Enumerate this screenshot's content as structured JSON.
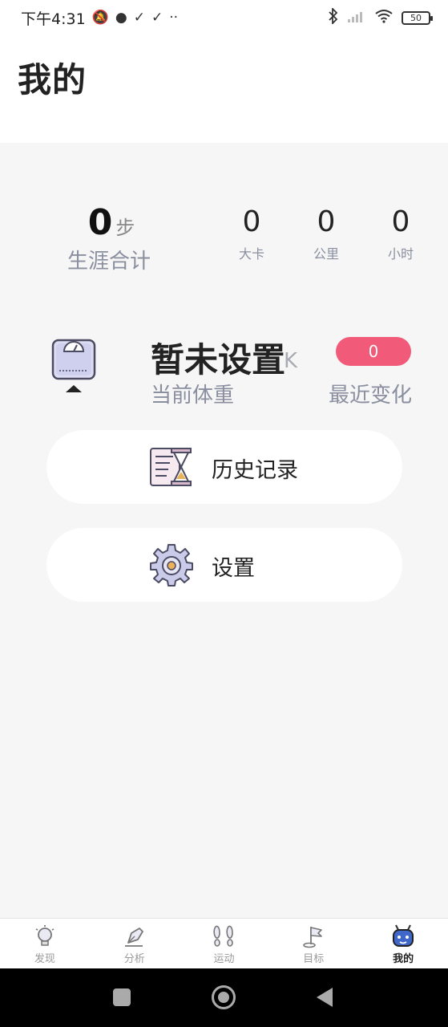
{
  "status_bar": {
    "time": "下午4:31",
    "battery": "50"
  },
  "header": {
    "title": "我的"
  },
  "stats": {
    "career_value": "0",
    "career_unit": "步",
    "career_label": "生涯合计",
    "items": [
      {
        "value": "0",
        "label": "大卡"
      },
      {
        "value": "0",
        "label": "公里"
      },
      {
        "value": "0",
        "label": "小时"
      }
    ]
  },
  "weight": {
    "current_value": "暂未设置",
    "unit": "K",
    "current_label": "当前体重",
    "change_value": "0",
    "change_label": "最近变化"
  },
  "menu": {
    "history_label": "历史记录",
    "settings_label": "设置"
  },
  "tabbar": {
    "tabs": [
      {
        "label": "发现",
        "icon": "lightbulb-icon"
      },
      {
        "label": "分析",
        "icon": "pen-icon"
      },
      {
        "label": "运动",
        "icon": "footprints-icon"
      },
      {
        "label": "目标",
        "icon": "flag-icon"
      },
      {
        "label": "我的",
        "icon": "robot-face-icon"
      }
    ]
  },
  "colors": {
    "accent": "#f15a78",
    "muted_text": "#8a8fa0",
    "background": "#f6f6f6"
  }
}
